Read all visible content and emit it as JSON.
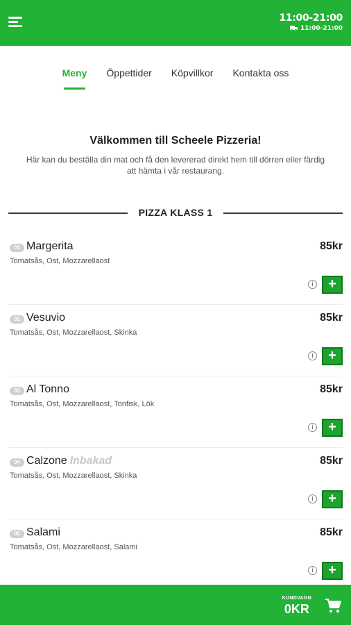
{
  "header": {
    "hours_main": "11:00-21:00",
    "hours_delivery": "11:00-21:00",
    "menu_icon": "hamburger-menu-icon",
    "delivery_icon": "truck-icon"
  },
  "nav": {
    "tabs": [
      {
        "label": "Meny",
        "active": true
      },
      {
        "label": "Öppettider",
        "active": false
      },
      {
        "label": "Köpvillkor",
        "active": false
      },
      {
        "label": "Kontakta oss",
        "active": false
      }
    ]
  },
  "welcome": {
    "title": "Välkommen till Scheele Pizzeria!",
    "text": "Här kan du beställa din mat och få den levererad direkt hem till dörren eller färdig att hämta i vår restaurang."
  },
  "section": {
    "title": "PIZZA KLASS 1"
  },
  "items": [
    {
      "number": "01",
      "name": "Margerita",
      "tag": "",
      "description": "Tomatsås, Ost, Mozzarellaost",
      "price": "85kr"
    },
    {
      "number": "02",
      "name": "Vesuvio",
      "tag": "",
      "description": "Tomatsås, Ost, Mozzarellaost, Skinka",
      "price": "85kr"
    },
    {
      "number": "03",
      "name": "Al Tonno",
      "tag": "",
      "description": "Tomatsås, Ost, Mozzarellaost, Tonfisk, Lök",
      "price": "85kr"
    },
    {
      "number": "04",
      "name": "Calzone",
      "tag": "Inbakad",
      "description": "Tomatsås, Ost, Mozzarellaost, Skinka",
      "price": "85kr"
    },
    {
      "number": "05",
      "name": "Salami",
      "tag": "",
      "description": "Tomatsås, Ost, Mozzarellaost, Salami",
      "price": "85kr"
    }
  ],
  "buttons": {
    "add_label": "+",
    "info_label": "i"
  },
  "footer": {
    "cart_label": "KUNDVAGN",
    "cart_total": "0KR",
    "cart_icon": "shopping-cart-icon"
  },
  "colors": {
    "brand_green": "#22b336",
    "add_button": "#1ea32e"
  }
}
